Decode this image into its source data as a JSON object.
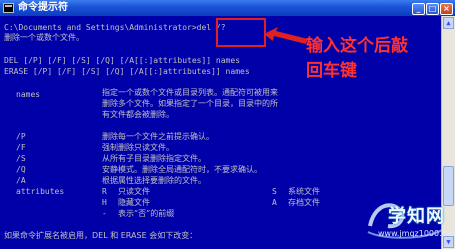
{
  "window": {
    "title": "命令提示符"
  },
  "console": {
    "prompt_path": "C:\\Documents and Settings\\Administrator>",
    "command": "del /?",
    "lines": {
      "desc": "删除一个或数个文件。",
      "syntax_del": "DEL [/P] [/F] [/S] [/Q] [/A[[:]attributes]] names",
      "syntax_erase": "ERASE [/P] [/F] [/S] [/Q] [/A[[:]attributes]] names",
      "names_key": "names",
      "names_desc_1": "指定一个或数个文件或目录列表。通配符可被用来",
      "names_desc_2": "删除多个文件。如果指定了一个目录，目录中的所",
      "names_desc_3": "有文件都会被删除。",
      "p_key": "/P",
      "p_desc": "删除每一个文件之前提示确认。",
      "f_key": "/F",
      "f_desc": "强制删除只读文件。",
      "s_key": "/S",
      "s_desc": "从所有子目录删除指定文件。",
      "q_key": "/Q",
      "q_desc": "安静模式。删除全局通配符时，不要求确认。",
      "a_key": "/A",
      "a_desc": "根据属性选择要删除的文件。",
      "attr_key": "attributes",
      "r_key": "R",
      "r_desc": "只读文件",
      "s2_key": "S",
      "s2_desc": "系统文件",
      "h_key": "H",
      "h_desc": "隐藏文件",
      "a2_key": "A",
      "a2_desc": "存档文件",
      "neg_key": "-",
      "neg_desc": "表示“否”的前缀",
      "ext_line": "如果命令扩展名被启用，DEL 和 ERASE 会如下改变："
    }
  },
  "annotation": {
    "text_line1": "输入这个后敲",
    "text_line2": "回车键",
    "color": "#ff3030"
  },
  "watermark": {
    "brand": "学知网",
    "url": "www.jmqz1000.com"
  },
  "colors": {
    "console_bg": "#0000a8",
    "console_fg": "#c0c0c0",
    "titlebar": "#1d55d8",
    "highlight": "#e02020"
  }
}
